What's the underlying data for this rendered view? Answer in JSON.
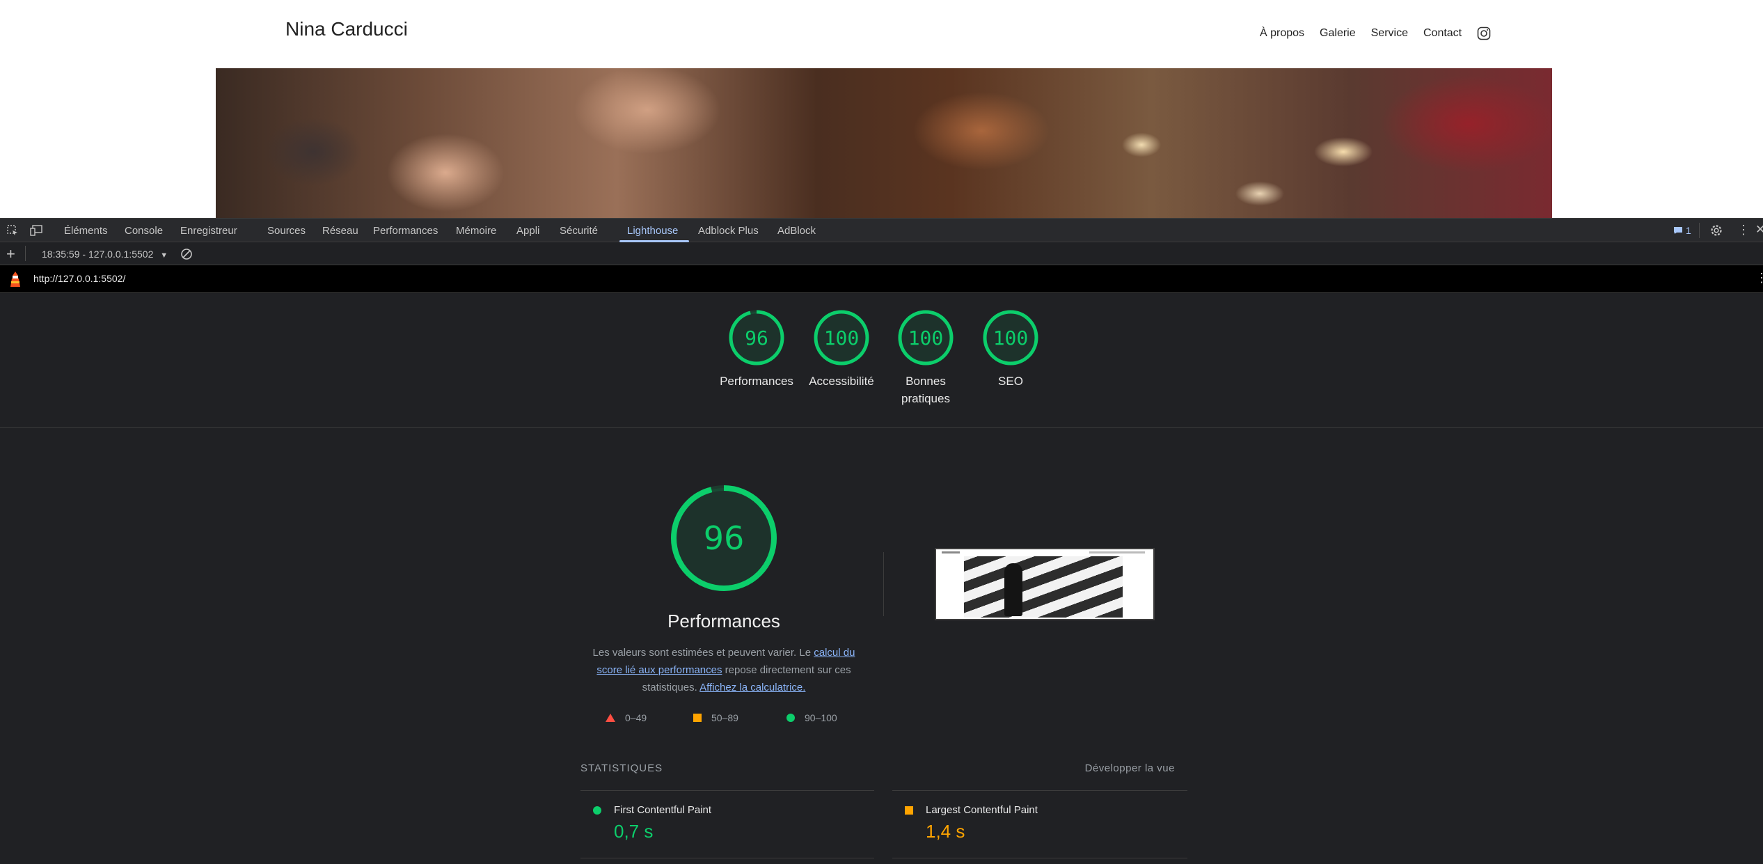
{
  "website": {
    "site_name": "Nina Carducci",
    "nav": [
      "À propos",
      "Galerie",
      "Service",
      "Contact"
    ]
  },
  "devtools": {
    "tabs": [
      "Éléments",
      "Console",
      "Enregistreur",
      "Sources",
      "Réseau",
      "Performances",
      "Mémoire",
      "Appli",
      "Sécurité",
      "Lighthouse",
      "Adblock Plus",
      "AdBlock"
    ],
    "active_tab": "Lighthouse",
    "issues_count": "1",
    "report_selector": "18:35:59 - 127.0.0.1:5502",
    "url": "http://127.0.0.1:5502/"
  },
  "lighthouse": {
    "scores": [
      {
        "value": "96",
        "label": "Performances",
        "score": 96
      },
      {
        "value": "100",
        "label": "Accessibilité",
        "score": 100
      },
      {
        "value": "100",
        "label": "Bonnes pratiques",
        "score": 100
      },
      {
        "value": "100",
        "label": "SEO",
        "score": 100
      }
    ],
    "performance": {
      "score": "96",
      "title": "Performances",
      "desc_prefix": "Les valeurs sont estimées et peuvent varier. Le ",
      "desc_link1": "calcul du score lié aux performances",
      "desc_middle": " repose directement sur ces statistiques. ",
      "desc_link2": "Affichez la calculatrice."
    },
    "legend": {
      "bad": "0–49",
      "average": "50–89",
      "good": "90–100"
    },
    "stats": {
      "heading": "STATISTIQUES",
      "expand": "Développer la vue",
      "items": [
        {
          "name": "First Contentful Paint",
          "value": "0,7 s",
          "status": "good"
        },
        {
          "name": "Largest Contentful Paint",
          "value": "1,4 s",
          "status": "average"
        }
      ]
    },
    "colors": {
      "good": "#0cce6b",
      "average": "#ffa400",
      "bad": "#ff4e42"
    }
  }
}
